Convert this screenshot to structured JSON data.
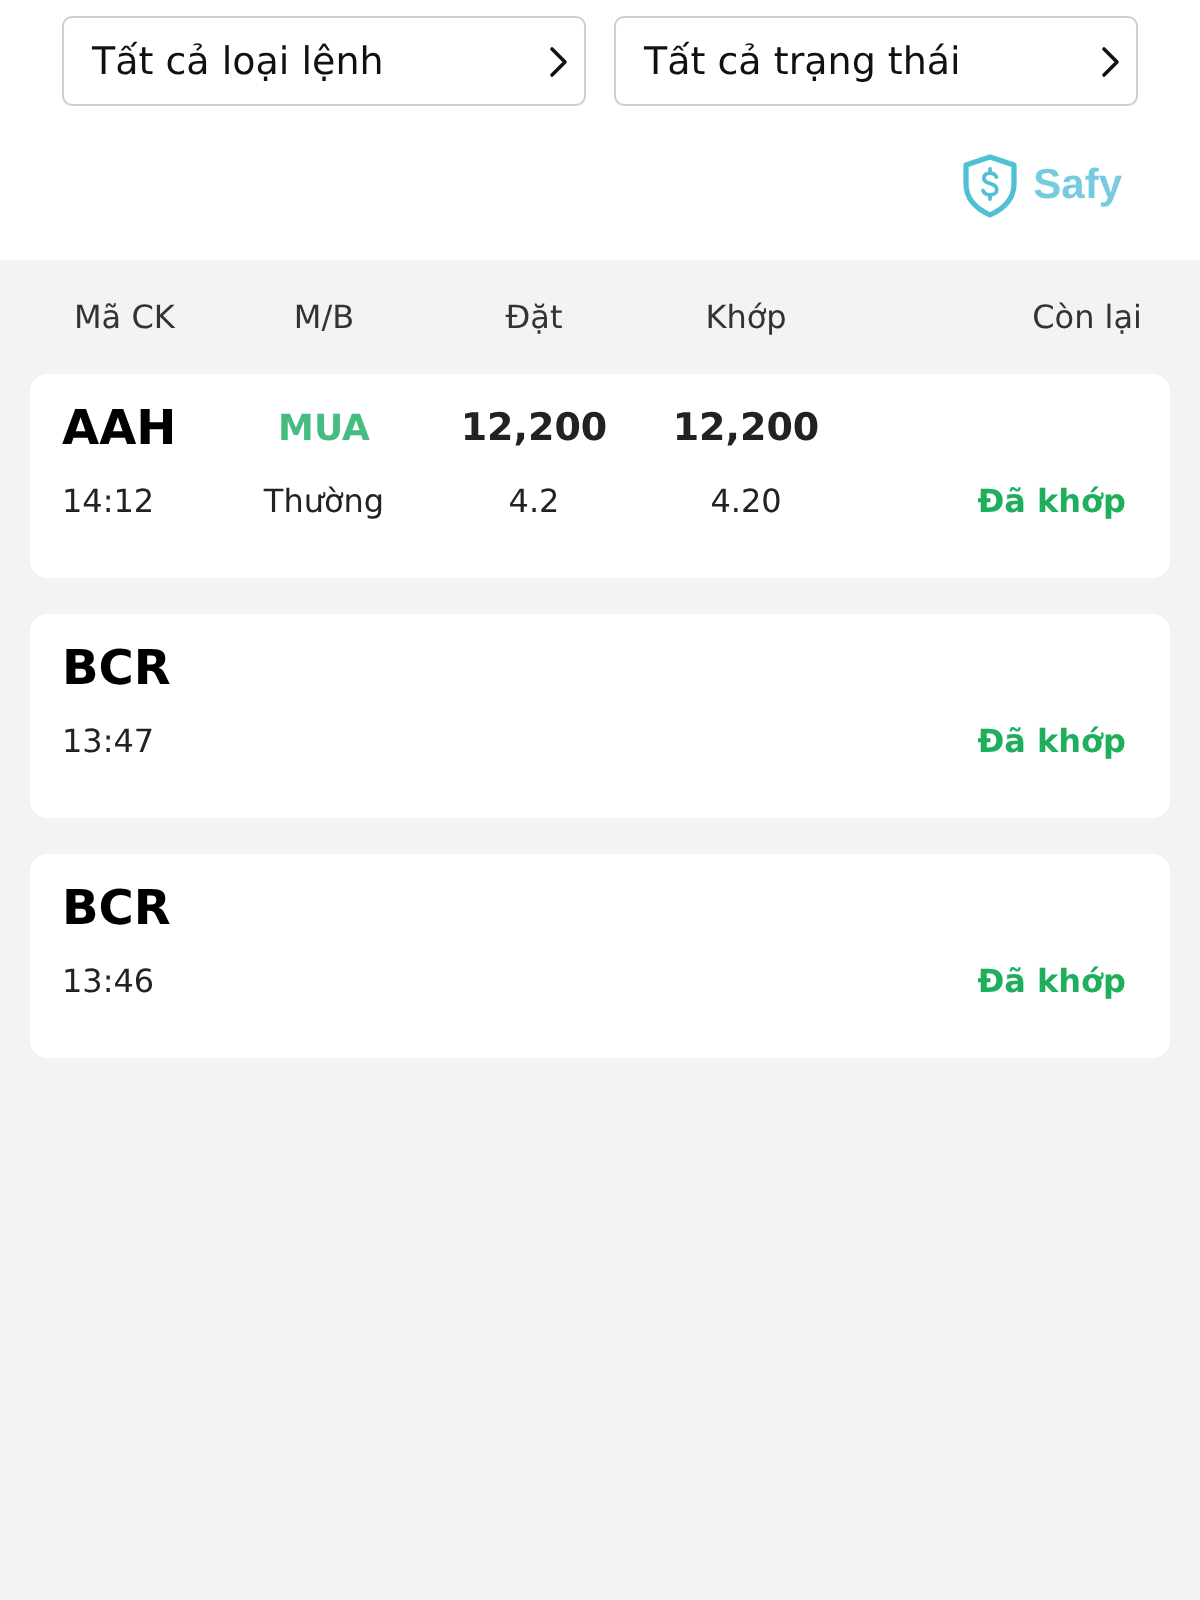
{
  "filters": [
    {
      "label": "Tất cả loại lệnh"
    },
    {
      "label": "Tất cả trạng thái"
    }
  ],
  "logo": {
    "text": "Safy"
  },
  "table": {
    "columns": [
      "Mã CK",
      "M/B",
      "Đặt",
      "Khớp",
      "Còn lại"
    ],
    "rows": [
      {
        "symbol": "AAH",
        "side": "MUA",
        "order_price": "12,200",
        "matched_price": "12,200",
        "time": "14:12",
        "order_type": "Thường",
        "order_quantity": "4.2",
        "matched_quantity": "4.20",
        "status": "Đã khớp"
      },
      {
        "symbol": "BCR",
        "time": "13:47",
        "status": "Đã khớp"
      },
      {
        "symbol": "BCR",
        "time": "13:46",
        "status": "Đã khớp"
      }
    ]
  }
}
